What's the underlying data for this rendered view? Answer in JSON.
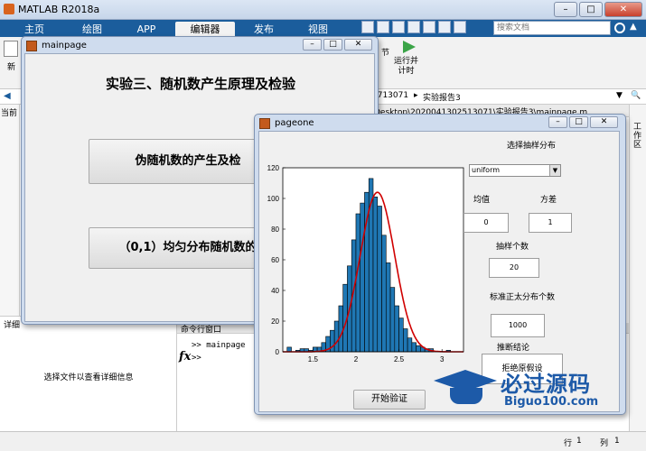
{
  "app": {
    "title": "MATLAB R2018a"
  },
  "ribbon": {
    "tabs": [
      {
        "label": "主页"
      },
      {
        "label": "绘图"
      },
      {
        "label": "APP"
      },
      {
        "label": "编辑器"
      },
      {
        "label": "发布"
      },
      {
        "label": "视图"
      }
    ],
    "search_placeholder": "搜索文档",
    "toolstrip": {
      "new_label": "新",
      "run_advance_label": "运行并\n计时",
      "section_label": "节"
    }
  },
  "pathbar": {
    "crumb1": "0713071",
    "crumb2": "实验报告3",
    "fullpath": "Desktop\\2020041302513071\\实验报告3\\mainpage.m"
  },
  "leftpanel": {
    "current_label": "当前"
  },
  "detail": {
    "title": "详细",
    "hint": "选择文件以查看详细信息"
  },
  "cmdwin": {
    "title": "命令行窗口",
    "line1": ">> mainpage",
    "prompt": ">>",
    "fx": "fx"
  },
  "rightstrip": {
    "label": "工作区"
  },
  "status": {
    "row_label": "行",
    "row_value": "1",
    "col_label": "列",
    "col_value": "1"
  },
  "mainpage": {
    "title": "mainpage",
    "heading": "实验三、随机数产生原理及检验",
    "button1": "伪随机数的产生及检",
    "button2": "（0,1）均匀分布随机数的"
  },
  "pageone": {
    "title": "pageone",
    "dist_label": "选择抽样分布",
    "dist_value": "uniform",
    "mean_label": "均值",
    "mean_value": "0",
    "var_label": "方差",
    "var_value": "1",
    "n_label": "抽样个数",
    "n_value": "20",
    "normal_count_label": "标准正太分布个数",
    "normal_count_value": "1000",
    "conclusion_label": "推断结论",
    "conclusion_value": "拒绝原假设",
    "start_button": "开始验证"
  },
  "watermark": {
    "text1": "必过源码",
    "text2": "Biguo100.com"
  },
  "chart_data": {
    "type": "bar",
    "title": "",
    "xlabel": "",
    "ylabel": "",
    "xlim": [
      1.15,
      3.25
    ],
    "ylim": [
      0,
      120
    ],
    "xticks": [
      "1.5",
      "2",
      "2.5",
      "3"
    ],
    "yticks": [
      "0",
      "20",
      "40",
      "60",
      "80",
      "100",
      "120"
    ],
    "bin_width": 0.05,
    "bins_start": [
      1.2,
      1.3,
      1.35,
      1.4,
      1.45,
      1.5,
      1.55,
      1.6,
      1.65,
      1.7,
      1.75,
      1.8,
      1.85,
      1.9,
      1.95,
      2.0,
      2.05,
      2.1,
      2.15,
      2.2,
      2.25,
      2.3,
      2.35,
      2.4,
      2.45,
      2.5,
      2.55,
      2.6,
      2.65,
      2.7,
      2.75,
      2.8,
      2.85,
      3.05
    ],
    "values": [
      3,
      1,
      2,
      2,
      1,
      3,
      3,
      6,
      10,
      14,
      20,
      30,
      44,
      56,
      73,
      90,
      97,
      104,
      113,
      101,
      95,
      76,
      58,
      42,
      30,
      22,
      15,
      9,
      6,
      4,
      3,
      2,
      2,
      1
    ],
    "bar_color": "#1f77b4",
    "fit_curve": {
      "type": "normal",
      "mean": 2.25,
      "std": 0.2,
      "peak": 104,
      "color": "#d00000"
    }
  }
}
